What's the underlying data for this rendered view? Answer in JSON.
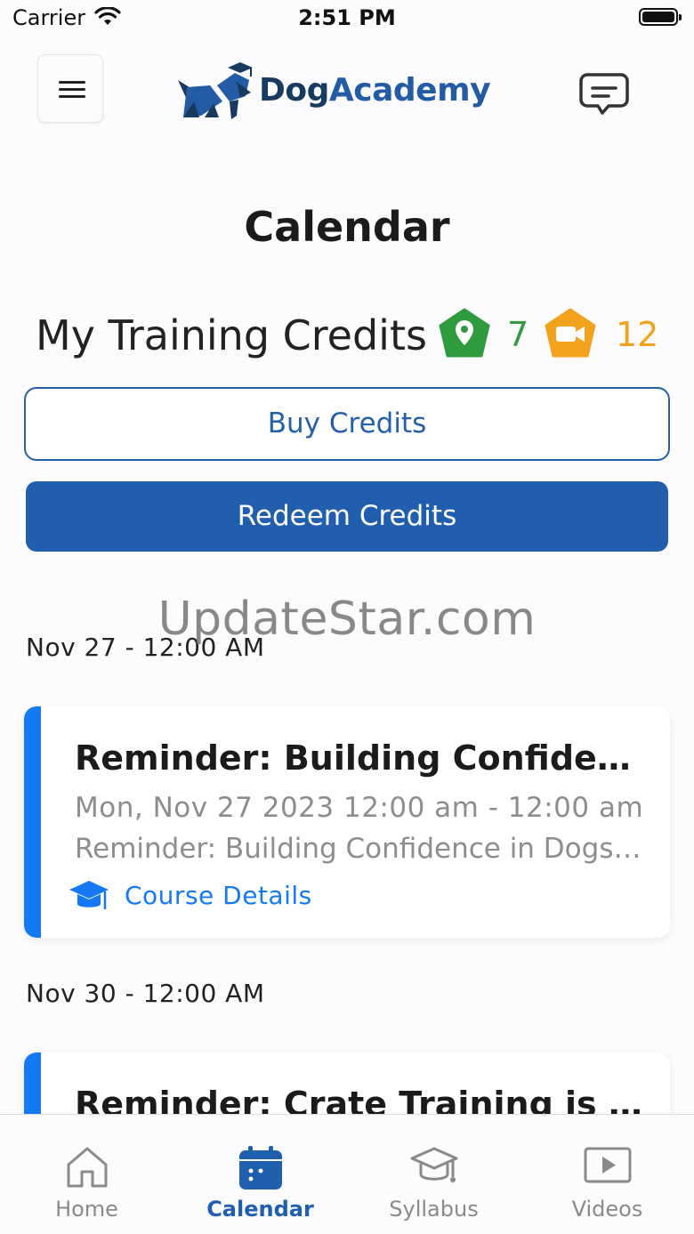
{
  "status_bar": {
    "carrier": "Carrier",
    "time": "2:51 PM"
  },
  "header": {
    "logo_part1": "Dog",
    "logo_part2": "Academy",
    "menu_icon": "hamburger-icon",
    "chat_icon": "chat-bubble-icon"
  },
  "page": {
    "title": "Calendar"
  },
  "credits": {
    "label": "My Training Credits",
    "in_person_count": "7",
    "virtual_count": "12",
    "in_person_icon": "location-pin-pentagon-icon",
    "virtual_icon": "video-camera-pentagon-icon",
    "in_person_color": "#2f9a3e",
    "virtual_color": "#f2a21c"
  },
  "actions": {
    "buy_label": "Buy Credits",
    "redeem_label": "Redeem Credits"
  },
  "watermark": "UpdateStar.com",
  "events": [
    {
      "date_header": "Nov 27 - 12:00 AM",
      "title": "Reminder: Building Confidence in Dogs",
      "time_range": "Mon, Nov 27 2023 12:00 am - 12:00 am",
      "description": "Reminder: Building Confidence in Dogs is due",
      "link_label": "Course Details"
    },
    {
      "date_header": "Nov 30 - 12:00 AM",
      "title": "Reminder: Crate Training is due"
    }
  ],
  "tabs": [
    {
      "label": "Home",
      "icon": "home-icon",
      "active": false
    },
    {
      "label": "Calendar",
      "icon": "calendar-icon",
      "active": true
    },
    {
      "label": "Syllabus",
      "icon": "graduation-cap-icon",
      "active": false
    },
    {
      "label": "Videos",
      "icon": "play-icon",
      "active": false
    }
  ],
  "colors": {
    "brand_dark": "#193a5f",
    "brand_blue": "#215fae",
    "accent_blue": "#1479f3"
  }
}
